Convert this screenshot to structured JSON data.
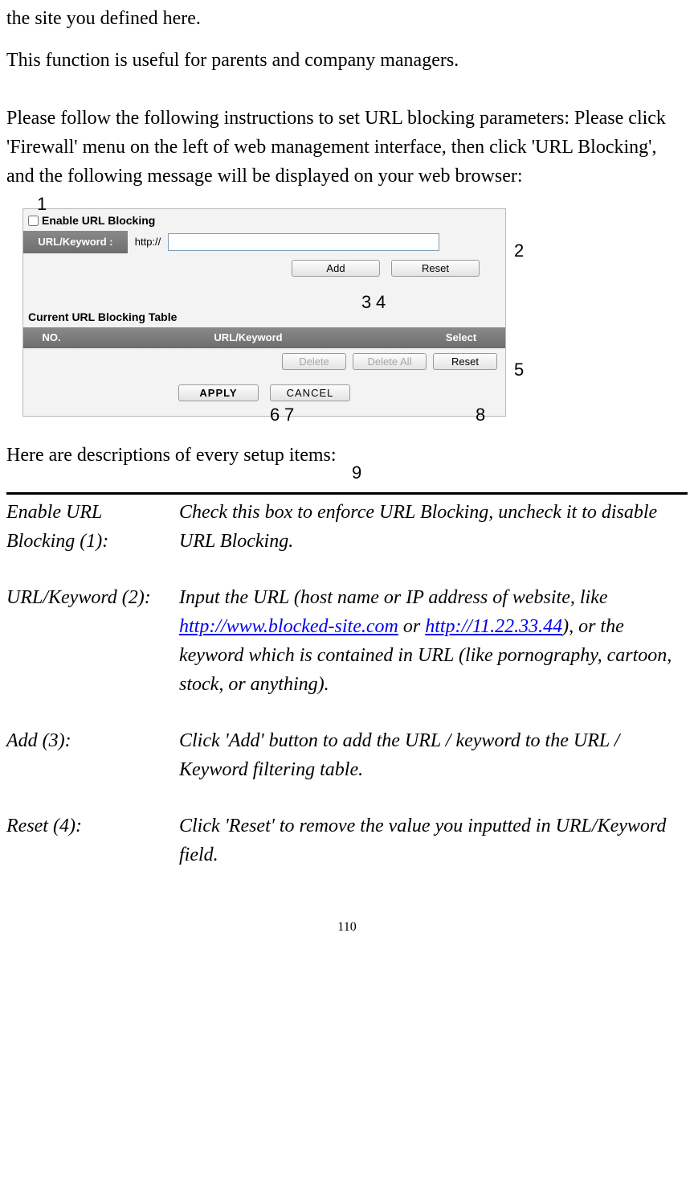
{
  "paragraphs": {
    "p1": "the site you defined here.",
    "p2": "This function is useful for parents and company managers.",
    "p3": "Please follow the following instructions to set URL blocking parameters: Please click 'Firewall' menu on the left of web management interface, then click 'URL Blocking', and the following message will be displayed on your web browser:",
    "desc_intro": "Here are descriptions of every setup items:"
  },
  "ui": {
    "enable_label": "Enable URL Blocking",
    "url_label": "URL/Keyword :",
    "url_prefix": "http://",
    "url_value": "",
    "add_btn": "Add",
    "reset_btn": "Reset",
    "table_title": "Current URL Blocking Table",
    "col_no": "NO.",
    "col_url": "URL/Keyword",
    "col_select": "Select",
    "delete_btn": "Delete",
    "delete_all_btn": "Delete All",
    "reset2_btn": "Reset",
    "apply_btn": "APPLY",
    "cancel_btn": "CANCEL"
  },
  "callouts": {
    "c1": "1",
    "c2": "2",
    "c3": "3",
    "c4": "4",
    "c5": "5",
    "c6": "6",
    "c7": "7",
    "c8": "8",
    "c9": "9"
  },
  "descriptions": {
    "r1_term": "Enable URL Blocking (1):",
    "r1_def": "Check this box to enforce URL Blocking, uncheck it to disable URL Blocking.",
    "r2_term": "URL/Keyword (2):",
    "r2_def_a": "Input the URL (host name or IP address of website, like ",
    "r2_link1": "http://www.blocked-site.com",
    "r2_def_b": " or ",
    "r2_link2": "http://11.22.33.44",
    "r2_def_c": "), or the keyword which is contained in URL (like pornography, cartoon, stock, or anything).",
    "r3_term": "Add (3):",
    "r3_def": "Click 'Add' button to add the URL / keyword to the URL / Keyword filtering table.",
    "r4_term": "Reset (4):",
    "r4_def": "Click 'Reset' to remove the value you inputted in URL/Keyword field."
  },
  "page_number": "110"
}
